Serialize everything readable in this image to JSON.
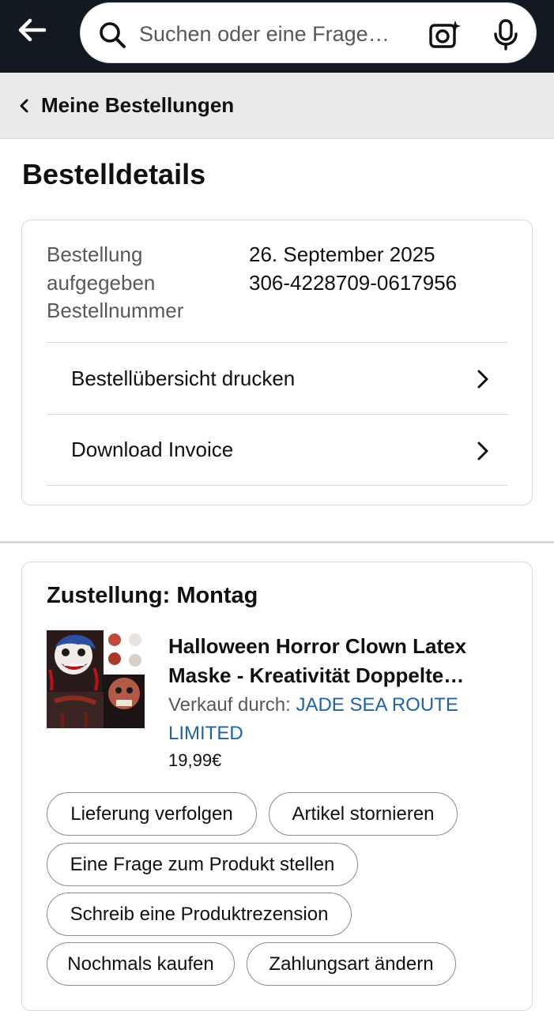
{
  "topbar": {
    "search_placeholder": "Suchen oder eine Frage…"
  },
  "breadcrumb": {
    "label": "Meine Bestellungen"
  },
  "page": {
    "title": "Bestelldetails"
  },
  "order_info": {
    "placed_label": "Bestellung aufgegeben",
    "number_label": "Bestellnummer",
    "placed_value": "26. September 2025",
    "number_value": "306-4228709-0617956",
    "actions": [
      {
        "label": "Bestellübersicht drucken"
      },
      {
        "label": "Download Invoice"
      }
    ]
  },
  "delivery": {
    "title": "Zustellung: Montag",
    "product": {
      "title": "Halloween Horror Clown Latex Maske - Kreativität Doppelte…",
      "seller_prefix": "Verkauf durch:",
      "seller_name": "JADE SEA ROUTE LIMITED",
      "price": "19,99€"
    },
    "buttons": [
      {
        "label": "Lieferung verfolgen"
      },
      {
        "label": "Artikel stornieren"
      },
      {
        "label": "Eine Frage zum Produkt stellen"
      },
      {
        "label": "Schreib eine Produktrezension"
      },
      {
        "label": "Nochmals kaufen"
      },
      {
        "label": "Zahlungsart ändern"
      }
    ]
  },
  "colors": {
    "topbar_bg": "#131921",
    "breadcrumb_bg": "#e9ebeb",
    "link": "#2162a1",
    "secondary_text": "#565959",
    "border": "#d5d9d9"
  }
}
